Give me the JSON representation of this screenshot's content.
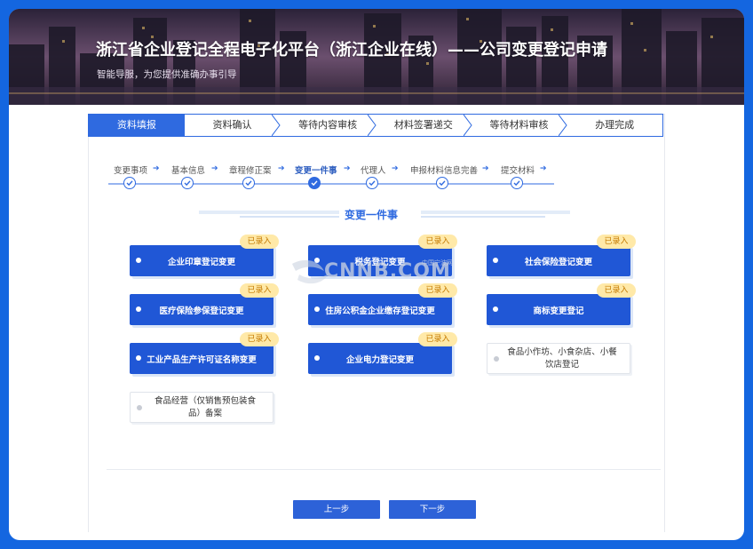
{
  "banner": {
    "title": "浙江省企业登记全程电子化平台（浙江企业在线）——公司变更登记申请",
    "subtitle": "智能导服，为您提供准确办事引导"
  },
  "tabs": [
    {
      "label": "资料填报",
      "active": true
    },
    {
      "label": "资料确认",
      "active": false
    },
    {
      "label": "等待内容审核",
      "active": false
    },
    {
      "label": "材料签署递交",
      "active": false
    },
    {
      "label": "等待材料审核",
      "active": false
    },
    {
      "label": "办理完成",
      "active": false
    }
  ],
  "steps": [
    {
      "label": "变更事项",
      "current": false
    },
    {
      "label": "基本信息",
      "current": false
    },
    {
      "label": "章程修正案",
      "current": false
    },
    {
      "label": "变更一件事",
      "current": true
    },
    {
      "label": "代理人",
      "current": false
    },
    {
      "label": "申报材料信息完善",
      "current": false
    },
    {
      "label": "提交材料",
      "current": false
    }
  ],
  "section_title": "变更一件事",
  "badge_label": "已录入",
  "items": [
    {
      "label": "企业印章登记变更",
      "entered": true
    },
    {
      "label": "税务登记变更",
      "entered": true
    },
    {
      "label": "社会保险登记变更",
      "entered": true
    },
    {
      "label": "医疗保险参保登记变更",
      "entered": true
    },
    {
      "label": "住房公积金企业缴存登记变更",
      "entered": true
    },
    {
      "label": "商标变更登记",
      "entered": true
    },
    {
      "label": "工业产品生产许可证名称变更",
      "entered": true
    },
    {
      "label": "企业电力登记变更",
      "entered": true
    },
    {
      "label": "食品小作坊、小食杂店、小餐饮店登记",
      "entered": false
    },
    {
      "label": "食品经营（仅销售预包装食品）备案",
      "entered": false
    }
  ],
  "buttons": {
    "prev": "上一步",
    "next": "下一步"
  },
  "watermark": {
    "text": "CNNB.COM",
    "small": "中国宁波网"
  },
  "colors": {
    "primary": "#2057d6",
    "badge_bg": "#ffe9a8",
    "badge_text": "#c57a00",
    "frame": "#1466e0"
  }
}
